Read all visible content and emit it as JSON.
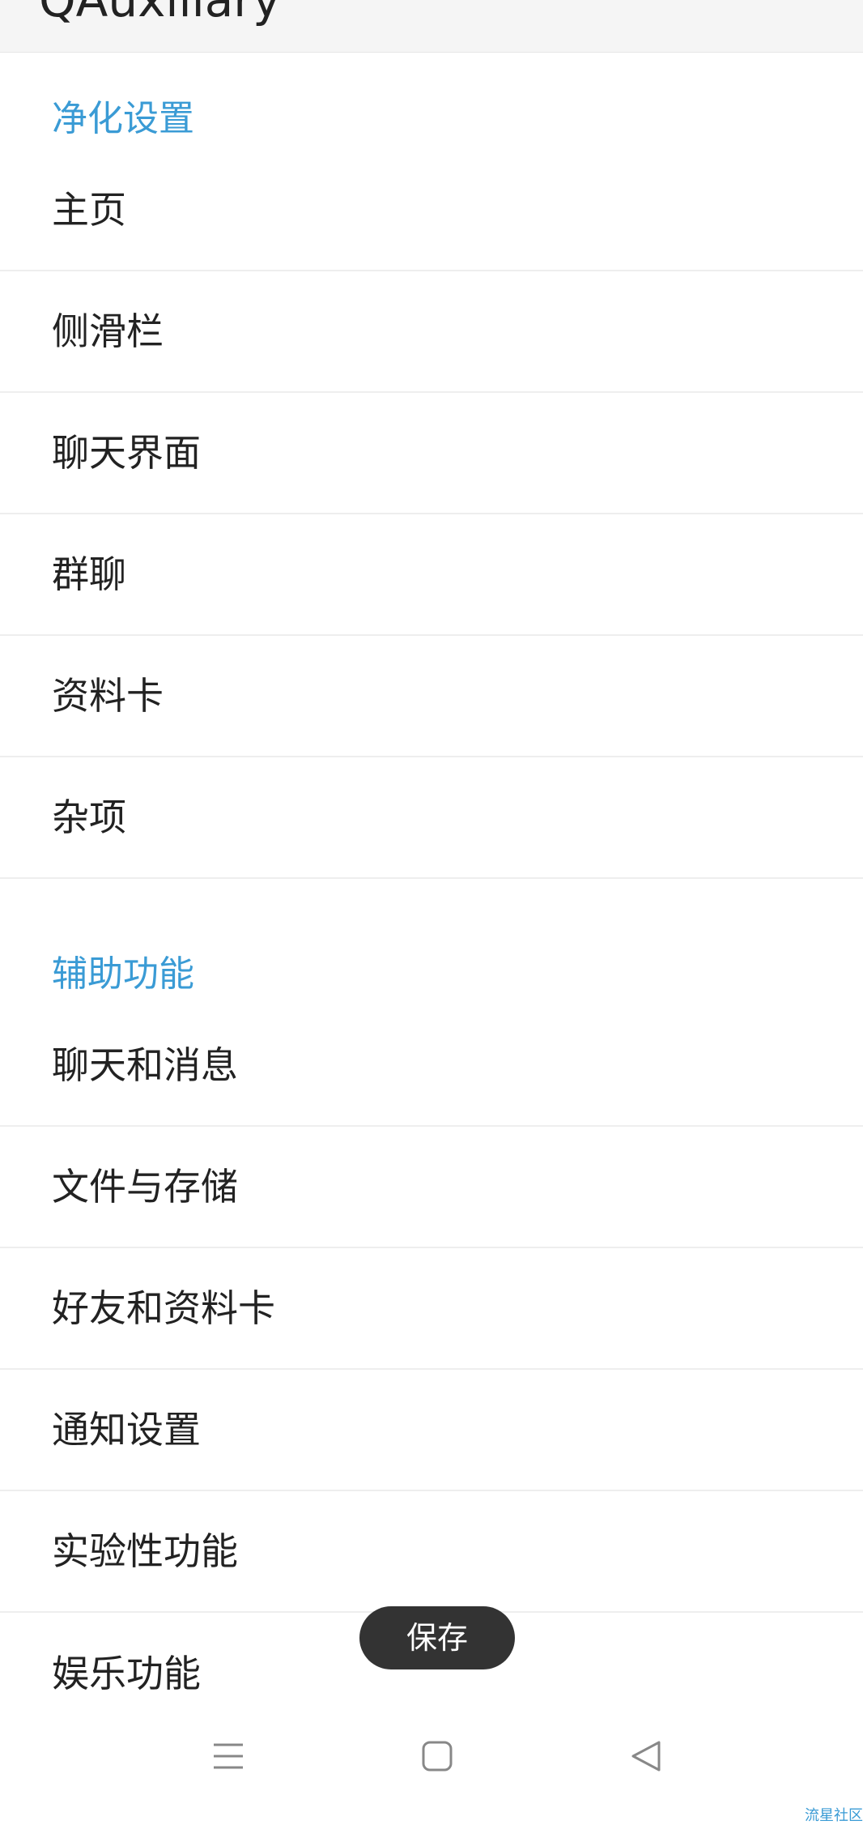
{
  "appbar": {
    "title": "QAuxiliary"
  },
  "sections": [
    {
      "header": "净化设置",
      "items": [
        {
          "label": "主页"
        },
        {
          "label": "侧滑栏"
        },
        {
          "label": "聊天界面"
        },
        {
          "label": "群聊"
        },
        {
          "label": "资料卡"
        },
        {
          "label": "杂项"
        }
      ]
    },
    {
      "header": "辅助功能",
      "items": [
        {
          "label": "聊天和消息"
        },
        {
          "label": "文件与存储"
        },
        {
          "label": "好友和资料卡"
        },
        {
          "label": "通知设置"
        },
        {
          "label": "实验性功能"
        },
        {
          "label": "娱乐功能"
        }
      ]
    }
  ],
  "toast": {
    "text": "保存"
  },
  "navbar": {
    "icons": [
      "menu-icon",
      "home-square-icon",
      "back-triangle-icon"
    ]
  },
  "watermark": "流星社区",
  "colors": {
    "accent": "#3a9bd5",
    "text": "#222222",
    "divider": "#eeeeee",
    "toast_bg": "#333333"
  }
}
